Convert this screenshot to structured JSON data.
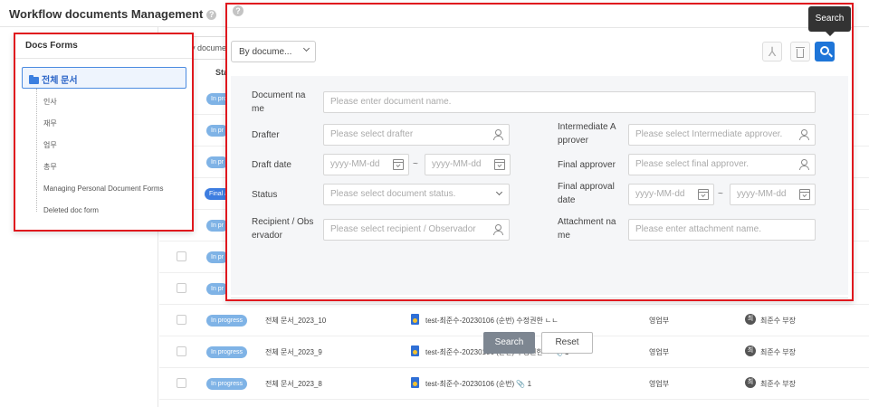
{
  "header": {
    "title": "Workflow documents Management",
    "help_icon": "?"
  },
  "background": {
    "doc_select": "By docume...",
    "status_header": "Sta",
    "rows": [
      {
        "status": "In pro",
        "docno": "",
        "title": "",
        "dept": "",
        "avatar": "",
        "drafter": ""
      },
      {
        "status": "In pr",
        "docno": "",
        "title": "",
        "dept": "",
        "avatar": "",
        "drafter": ""
      },
      {
        "status": "In pr",
        "docno": "",
        "title": "",
        "dept": "",
        "avatar": "",
        "drafter": ""
      },
      {
        "status": "Final a",
        "docno": "",
        "title": "",
        "dept": "",
        "avatar": "",
        "drafter": ""
      },
      {
        "status": "In pr",
        "docno": "",
        "title": "",
        "dept": "",
        "avatar": "",
        "drafter": ""
      },
      {
        "status": "In pr",
        "docno": "",
        "title": "",
        "dept": "",
        "avatar": "",
        "drafter": ""
      },
      {
        "status": "In pr",
        "docno": "",
        "title": "",
        "dept": "",
        "avatar": "",
        "drafter": ""
      },
      {
        "status": "In progress",
        "docno": "전체 문서_2023_10",
        "title": "test-최준수-20230106 (순번) 수정권한 ㄴㄴ",
        "dept": "영업부",
        "avatar": "최",
        "drafter": "최준수 부장"
      },
      {
        "status": "In progress",
        "docno": "전체 문서_2023_9",
        "title": "test-최준수-20230106 (순번) 수정권한 ㅇ 📎 1",
        "dept": "영업부",
        "avatar": "최",
        "drafter": "최준수 부장"
      },
      {
        "status": "In progress",
        "docno": "전체 문서_2023_8",
        "title": "test-최준수-20230106 (순번) 📎 1",
        "dept": "영업부",
        "avatar": "최",
        "drafter": "최준수 부장"
      }
    ]
  },
  "forms_panel": {
    "title": "Docs Forms",
    "root": "전체 문서",
    "items": [
      "인사",
      "재무",
      "업무",
      "총무",
      "Managing Personal Document Forms",
      "Deleted doc form"
    ]
  },
  "search_panel": {
    "doc_select": "By docume...",
    "tooltip": "Search",
    "pdf_icon": "⅄",
    "labels": {
      "doc_name": "Document na me",
      "drafter": "Drafter",
      "draft_date": "Draft date",
      "status": "Status",
      "recipient": "Recipient / Obs ervador",
      "intermediate": "Intermediate A pprover",
      "final_approver": "Final approver",
      "final_date": "Final approval date",
      "attachment": "Attachment na me"
    },
    "placeholders": {
      "doc_name": "Please enter document name.",
      "drafter": "Please select drafter",
      "date": "yyyy-MM-dd",
      "status": "Please select document status.",
      "recipient": "Please select recipient / Observador",
      "intermediate": "Please select Intermediate approver.",
      "final_approver": "Please select final approver.",
      "attachment": "Please enter attachment name."
    },
    "tilde": "~",
    "search_button": "Search",
    "reset_button": "Reset"
  },
  "colors": {
    "highlight": "#e0181e",
    "primary": "#1e75d8",
    "badge": "#7fb3e6",
    "badge_final": "#3d7de0"
  }
}
